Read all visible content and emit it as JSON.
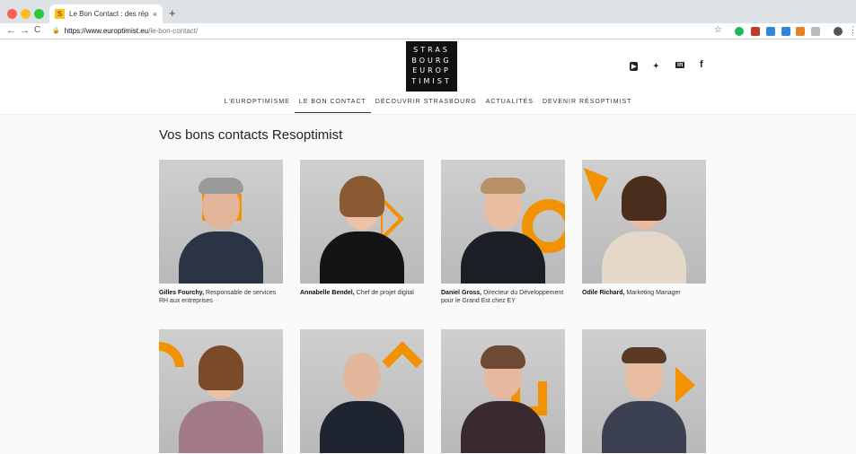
{
  "browser": {
    "tab_title": "Le Bon Contact : des réponses",
    "tab_favicon": "S",
    "tab_close": "×",
    "new_tab": "+",
    "url_host": "https://www.europtimist.eu",
    "url_path": "/le-bon-contact/",
    "back": "←",
    "forward": "→",
    "reload": "C",
    "star": "☆"
  },
  "logo": {
    "lines": [
      "STRAS",
      "BOURG",
      "EUROP",
      "TIMIST"
    ]
  },
  "social": {
    "youtube": "▶",
    "twitter": "🐦",
    "linkedin": "in",
    "facebook": "f"
  },
  "nav": [
    {
      "label": "L'EUROPTIMISME"
    },
    {
      "label": "LE BON CONTACT"
    },
    {
      "label": "DÉCOUVRIR STRASBOURG"
    },
    {
      "label": "ACTUALITÉS"
    },
    {
      "label": "DEVENIR RÉSOPTIMIST"
    }
  ],
  "page_title": "Vos bons contacts Resoptimist",
  "contacts": [
    {
      "name": "Gilles Fourchy,",
      "role": "Responsable de services RH aux entreprises"
    },
    {
      "name": "Annabelle Bendel,",
      "role": "Chef de projet digital"
    },
    {
      "name": "Daniel Gross,",
      "role": "Directeur du Développement pour le Grand Est chez EY"
    },
    {
      "name": "Odile Richard,",
      "role": "Marketing Manager"
    },
    {
      "name": "",
      "role": ""
    },
    {
      "name": "",
      "role": ""
    },
    {
      "name": "",
      "role": ""
    },
    {
      "name": "",
      "role": ""
    }
  ],
  "colors": {
    "accent": "#f39200",
    "logo_bg": "#111111"
  }
}
